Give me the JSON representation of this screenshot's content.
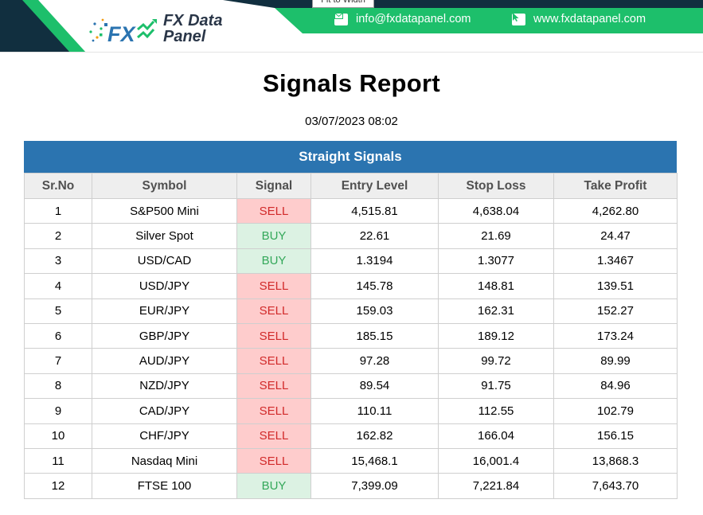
{
  "header": {
    "tooltip": "Fit to Width",
    "logo_fx": "FX",
    "brand_line1": "FX Data",
    "brand_line2": "Panel",
    "email": "info@fxdatapanel.com",
    "website": "www.fxdatapanel.com",
    "icons": [
      "email-icon",
      "cursor-icon"
    ],
    "colors": {
      "navy": "#112f3f",
      "green": "#1dbf6b",
      "blue": "#2b74b0"
    }
  },
  "report": {
    "title": "Signals Report",
    "date": "03/07/2023 08:02",
    "section_title": "Straight Signals"
  },
  "table": {
    "columns": [
      "Sr.No",
      "Symbol",
      "Signal",
      "Entry Level",
      "Stop Loss",
      "Take Profit"
    ],
    "rows": [
      [
        "1",
        "S&P500 Mini",
        "SELL",
        "4,515.81",
        "4,638.04",
        "4,262.80"
      ],
      [
        "2",
        "Silver Spot",
        "BUY",
        "22.61",
        "21.69",
        "24.47"
      ],
      [
        "3",
        "USD/CAD",
        "BUY",
        "1.3194",
        "1.3077",
        "1.3467"
      ],
      [
        "4",
        "USD/JPY",
        "SELL",
        "145.78",
        "148.81",
        "139.51"
      ],
      [
        "5",
        "EUR/JPY",
        "SELL",
        "159.03",
        "162.31",
        "152.27"
      ],
      [
        "6",
        "GBP/JPY",
        "SELL",
        "185.15",
        "189.12",
        "173.24"
      ],
      [
        "7",
        "AUD/JPY",
        "SELL",
        "97.28",
        "99.72",
        "89.99"
      ],
      [
        "8",
        "NZD/JPY",
        "SELL",
        "89.54",
        "91.75",
        "84.96"
      ],
      [
        "9",
        "CAD/JPY",
        "SELL",
        "110.11",
        "112.55",
        "102.79"
      ],
      [
        "10",
        "CHF/JPY",
        "SELL",
        "162.82",
        "166.04",
        "156.15"
      ],
      [
        "11",
        "Nasdaq Mini",
        "SELL",
        "15,468.1",
        "16,001.4",
        "13,868.3"
      ],
      [
        "12",
        "FTSE 100",
        "BUY",
        "7,399.09",
        "7,221.84",
        "7,643.70"
      ]
    ]
  }
}
